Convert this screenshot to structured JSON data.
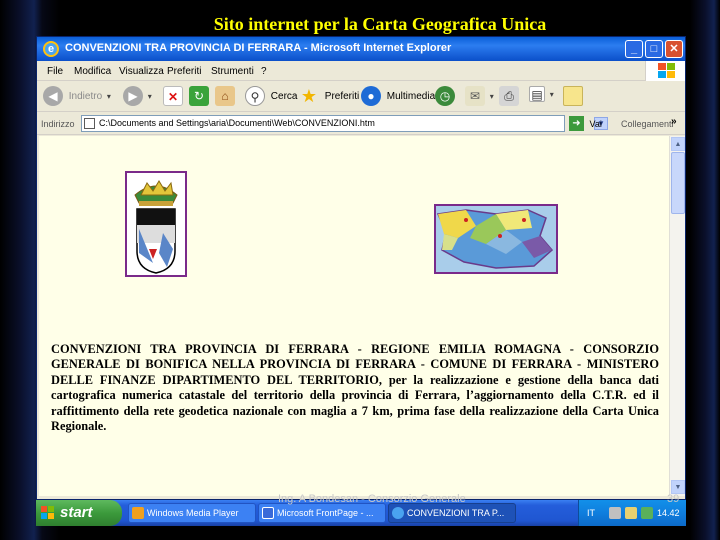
{
  "slide": {
    "title": "Sito internet per la Carta Geografica Unica",
    "footer": "Ing. A Bondesan - Consorzio Generale",
    "page_number": "39"
  },
  "window": {
    "title": "CONVENZIONI TRA PROVINCIA DI FERRARA - Microsoft Internet Explorer",
    "controls": {
      "minimize": "_",
      "maximize": "□",
      "close": "✕"
    }
  },
  "menu": {
    "items": [
      "File",
      "Modifica",
      "Visualizza",
      "Preferiti",
      "Strumenti",
      "?"
    ]
  },
  "toolbar": {
    "back": "Indietro",
    "search": "Cerca",
    "favorites": "Preferiti",
    "media": "Multimedia"
  },
  "address": {
    "label": "Indirizzo",
    "value": "C:\\Documents and Settings\\aria\\Documenti\\Web\\CONVENZIONI.htm",
    "go": "Vai",
    "links": "Collegamenti",
    "more": "»"
  },
  "content": {
    "body": "CONVENZIONI TRA PROVINCIA DI FERRARA - REGIONE EMILIA ROMAGNA - CONSORZIO GENERALE DI BONIFICA NELLA PROVINCIA DI FERRARA - COMUNE DI FERRARA - MINISTERO DELLE FINANZE DIPARTIMENTO DEL TERRITORIO, per la realizzazione e gestione della banca dati cartografica numerica catastale del territorio della provincia di Ferrara, l’aggiornamento della C.T.R. ed il raffittimento della rete geodetica nazionale con maglia a 7 km, prima fase della realizzazione della Carta Unica Regionale."
  },
  "taskbar": {
    "start": "start",
    "tasks": [
      "Windows Media Player",
      "Microsoft FrontPage - ...",
      "CONVENZIONI TRA P..."
    ],
    "lang": "IT",
    "time": "14.42"
  },
  "colors": {
    "slide_title": "#ffff00",
    "content_bg": "#ffffe8",
    "titlebar": "#0a5fd8"
  }
}
